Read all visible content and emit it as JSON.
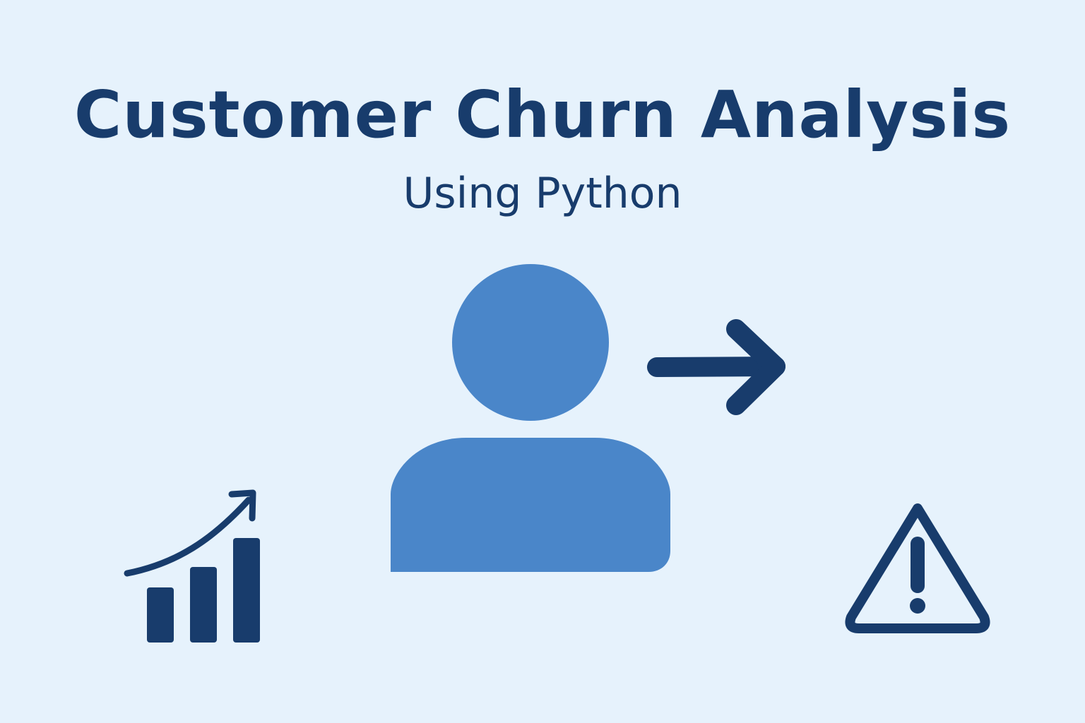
{
  "header": {
    "title": "Customer Churn Analysis",
    "subtitle": "Using Python"
  },
  "icons": {
    "person": "person-icon",
    "arrow": "arrow-right-icon",
    "chart": "growth-bar-chart-icon",
    "warning": "warning-triangle-icon"
  },
  "colors": {
    "background": "#e6f2fc",
    "primary_dark": "#183c6c",
    "person_blue": "#4a86c9"
  }
}
